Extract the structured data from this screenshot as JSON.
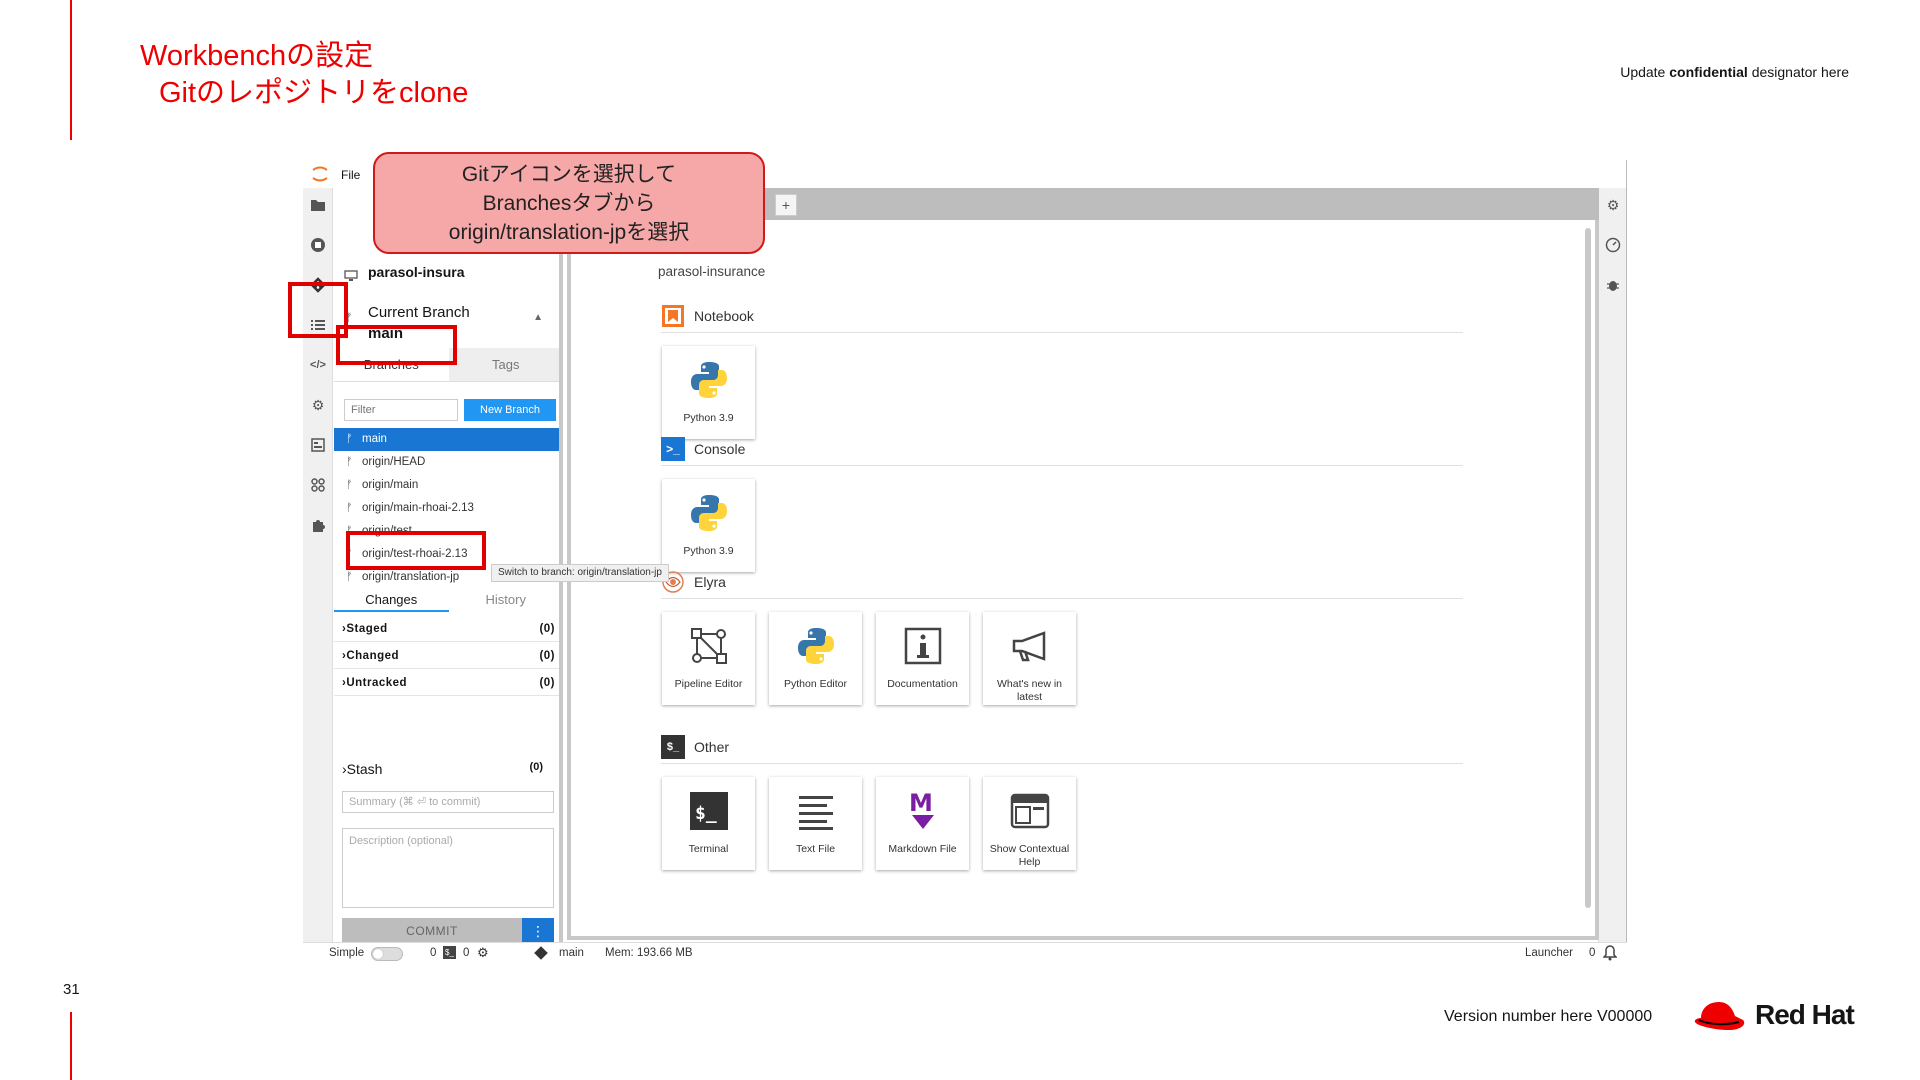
{
  "slide": {
    "title_line1": "Workbenchの設定",
    "title_line2": "Gitのレポジトリをclone",
    "confidential_prefix": "Update ",
    "confidential_bold": "confidential",
    "confidential_suffix": " designator here",
    "page_number": "31",
    "version": "Version number here V00000",
    "brand": "Red Hat",
    "accent_color": "#ee0000"
  },
  "callout": {
    "line1": "Gitアイコンを選択して",
    "line2": "Branchesタブから",
    "line3": "origin/translation-jpを選択"
  },
  "menubar": {
    "file": "File"
  },
  "git": {
    "repo_name": "parasol-insura",
    "current_branch_label": "Current Branch",
    "current_branch": "main",
    "tabs": {
      "branches": "Branches",
      "tags": "Tags"
    },
    "filter_placeholder": "Filter",
    "new_branch_label": "New Branch",
    "branches": [
      "main",
      "origin/HEAD",
      "origin/main",
      "origin/main-rhoai-2.13",
      "origin/test",
      "origin/test-rhoai-2.13",
      "origin/translation-jp"
    ],
    "tooltip": "Switch to branch: origin/translation-jp",
    "changes_tab": "Changes",
    "history_tab": "History",
    "sections": [
      {
        "label": "Staged",
        "count": "(0)"
      },
      {
        "label": "Changed",
        "count": "(0)"
      },
      {
        "label": "Untracked",
        "count": "(0)"
      }
    ],
    "stash_label": "Stash",
    "stash_count": "(0)",
    "summary_placeholder": "Summary (⌘ ⏎ to commit)",
    "description_placeholder": "Description (optional)",
    "commit_label": "COMMIT",
    "commit_more": "⋮"
  },
  "launcher": {
    "cwd": "parasol-insurance",
    "add_tab": "+",
    "sections": {
      "notebook": "Notebook",
      "console": "Console",
      "elyra": "Elyra",
      "other": "Other"
    },
    "notebook_cards": [
      "Python 3.9"
    ],
    "console_cards": [
      "Python 3.9"
    ],
    "elyra_cards": [
      "Pipeline Editor",
      "Python Editor",
      "Documentation",
      "What's new in latest"
    ],
    "other_cards": [
      "Terminal",
      "Text File",
      "Markdown File",
      "Show Contextual Help"
    ]
  },
  "statusbar": {
    "mode": "Simple",
    "kernels": "0",
    "terminals": "0",
    "branch": "main",
    "memory": "Mem: 193.66 MB",
    "tab_name": "Launcher",
    "notifications": "0"
  }
}
